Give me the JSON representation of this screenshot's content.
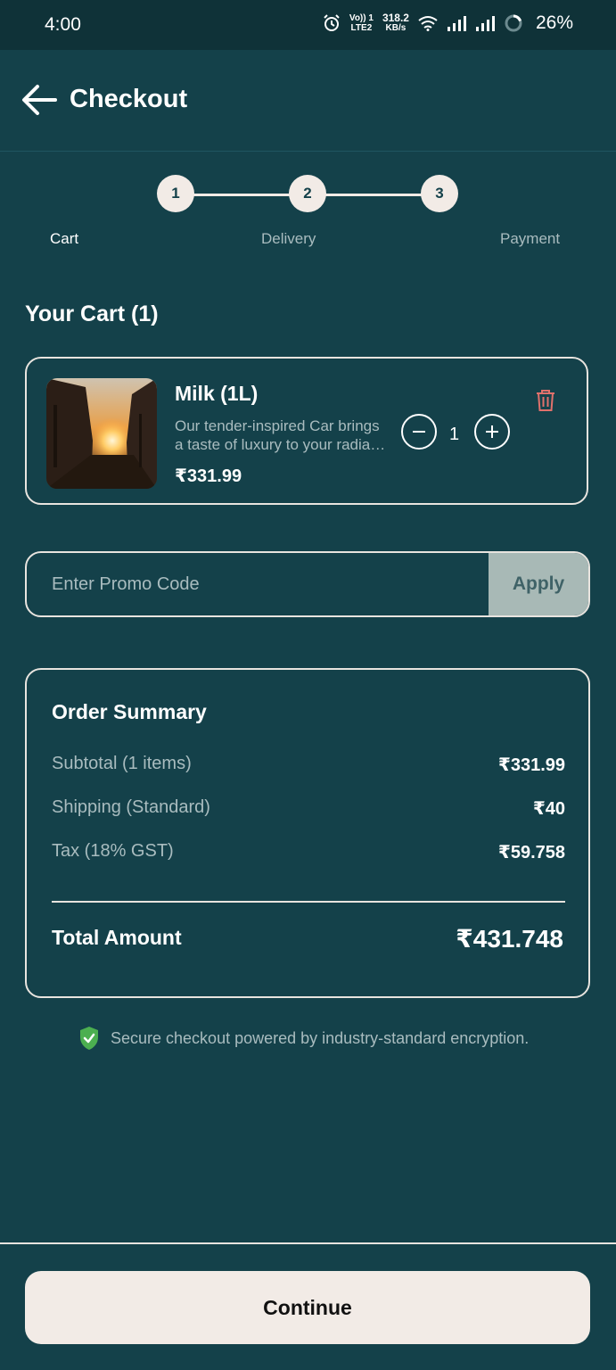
{
  "status_bar": {
    "time": "4:00",
    "network_top": "Vo)) 1",
    "network_bottom": "LTE2",
    "speed_value": "318.2",
    "speed_unit": "KB/s",
    "battery": "26%"
  },
  "header": {
    "title": "Checkout",
    "back_icon": "arrow-left-icon"
  },
  "stepper": {
    "steps": [
      {
        "number": "1",
        "label": "Cart"
      },
      {
        "number": "2",
        "label": "Delivery"
      },
      {
        "number": "3",
        "label": "Payment"
      }
    ],
    "active_index": 0
  },
  "cart": {
    "title": "Your Cart (1)",
    "items": [
      {
        "name": "Milk (1L)",
        "description_line1": "Our tender-inspired Car brings",
        "description_line2": "a taste of luxury to your radia…",
        "price": "₹331.99",
        "quantity": "1",
        "image": "city-street-sunset-photo"
      }
    ]
  },
  "promo": {
    "placeholder": "Enter Promo Code",
    "value": "",
    "apply_label": "Apply"
  },
  "summary": {
    "title": "Order Summary",
    "rows": [
      {
        "label": "Subtotal (1 items)",
        "value": "₹331.99"
      },
      {
        "label": "Shipping (Standard)",
        "value": "₹40"
      },
      {
        "label": "Tax (18% GST)",
        "value": "₹59.758"
      }
    ],
    "total_label": "Total Amount",
    "total_value": "₹431.748"
  },
  "secure_note": "Secure checkout powered by industry-standard encryption.",
  "continue_label": "Continue",
  "colors": {
    "background": "#14414a",
    "status_bar": "#0f3238",
    "light": "#f2ebe6",
    "muted_text": "#a9bcbf",
    "delete_red": "#e0716c",
    "secure_green": "#4caf50",
    "apply_bg": "#a8b9b6"
  }
}
